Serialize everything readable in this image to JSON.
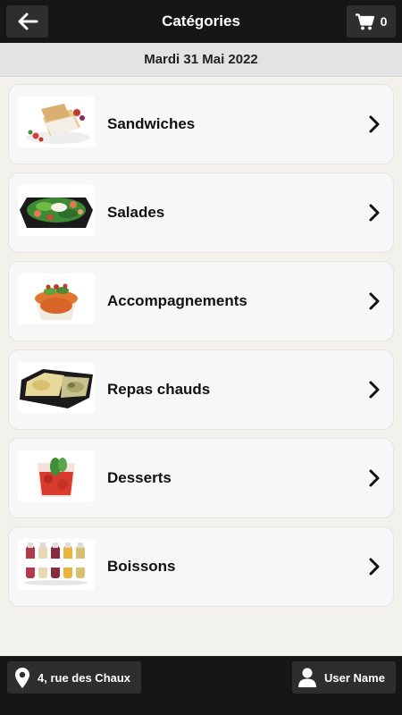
{
  "header": {
    "title": "Catégories",
    "back_icon": "arrow-left-icon",
    "cart_icon": "cart-icon",
    "cart_count": "0"
  },
  "date_label": "Mardi 31 Mai 2022",
  "categories": [
    {
      "label": "Sandwiches",
      "image": "sandwich-image"
    },
    {
      "label": "Salades",
      "image": "salad-image"
    },
    {
      "label": "Accompagnements",
      "image": "side-dish-image"
    },
    {
      "label": "Repas chauds",
      "image": "hot-meal-image"
    },
    {
      "label": "Desserts",
      "image": "dessert-image"
    },
    {
      "label": "Boissons",
      "image": "drinks-image"
    }
  ],
  "footer": {
    "location_icon": "map-pin-icon",
    "location_label": "4, rue des Chaux",
    "user_icon": "user-icon",
    "user_label": "User Name"
  },
  "colors": {
    "bar_background": "#161616",
    "button_background": "#2e2e2e",
    "page_background": "#f2f1ec",
    "card_background": "#f7f7f7"
  }
}
